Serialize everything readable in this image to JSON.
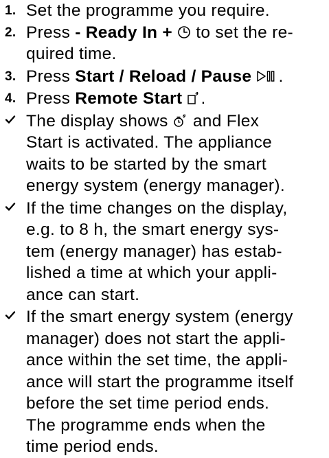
{
  "steps": [
    {
      "number": "1.",
      "text": "Set the programme you require."
    },
    {
      "number": "2.",
      "prefix": "Press ",
      "bold": "- Ready In +",
      "line1_after": " to set the re-",
      "line2": "quired time."
    },
    {
      "number": "3.",
      "prefix": "Press ",
      "bold": "Start / Reload / Pause",
      "suffix": "."
    },
    {
      "number": "4.",
      "prefix": "Press ",
      "bold": "Remote Start",
      "suffix": "."
    }
  ],
  "results": [
    {
      "line1_prefix": "The display shows ",
      "line1_suffix": " and Flex",
      "line2": "Start is activated. The appliance",
      "line3": "waits to be started by the smart",
      "line4": "energy system (energy manager)."
    },
    {
      "lines": [
        "If the time changes on the display,",
        "e.g. to 8 h, the smart energy sys-",
        "tem (energy manager) has estab-",
        "lished a time at which your appli-",
        "ance can start."
      ]
    },
    {
      "lines": [
        "If the smart energy system (energy",
        "manager) does not start the appli-",
        "ance within the set time, the appli-",
        "ance will start the programme itself",
        "before the set time period ends.",
        "The programme ends when the",
        "time period ends."
      ]
    }
  ],
  "icons": {
    "ready_in": "clock-icon",
    "start_pause": "start-pause-icon",
    "remote_start": "remote-start-icon",
    "flex_start": "flex-start-icon",
    "result_marker": "checkmark-icon"
  }
}
